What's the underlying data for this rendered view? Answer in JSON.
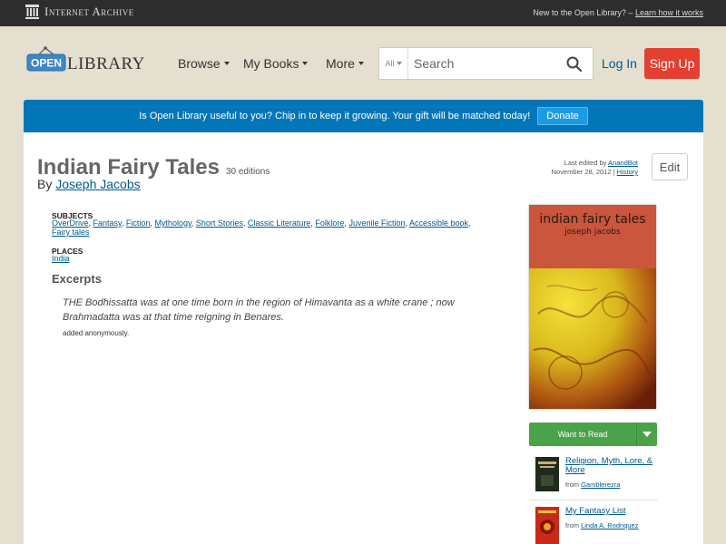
{
  "ia_bar": {
    "logo_text": "Internet Archive",
    "prompt": "New to the Open Library?",
    "link": "Learn how it works"
  },
  "header": {
    "logo_open": "OPEN",
    "logo_library": "LIBRARY",
    "nav": [
      {
        "label": "Browse"
      },
      {
        "label": "My Books"
      },
      {
        "label": "More"
      }
    ],
    "search": {
      "scope": "All",
      "placeholder": "Search"
    },
    "login": "Log In",
    "signup": "Sign Up"
  },
  "donate": {
    "message": "Is Open Library useful to you? Chip in to keep it growing. Your gift will be matched today!",
    "button": "Donate"
  },
  "work": {
    "title": "Indian Fairy Tales",
    "editions": "30 editions",
    "by": "By",
    "author": "Joseph Jacobs",
    "last_edited_label": "Last edited by",
    "last_edited_user": "AnandBot",
    "last_edited_date": "November 28, 2012",
    "history": "History",
    "edit_button": "Edit",
    "subjects_head": "Subjects",
    "subjects": [
      "OverDrive",
      "Fantasy",
      "Fiction",
      "Mythology",
      "Short Stories",
      "Classic Literature",
      "Folklore",
      "Juvenile Fiction",
      "Accessible book",
      "Fairy tales"
    ],
    "places_head": "Places",
    "places": [
      "India"
    ],
    "excerpts_head": "Excerpts",
    "excerpt": "THE Bodhissatta was at one time born in the region of Himavanta as a white crane ; now Brahmadatta was at that time reigning in Benares.",
    "excerpt_added": "added anonymously."
  },
  "cover": {
    "title": "indian fairy tales",
    "author": "joseph jacobs"
  },
  "want_to_read": "Want to Read",
  "lists": [
    {
      "title": "Religion, Myth, Lore, & More",
      "from_label": "from",
      "user": "Gamblerezra"
    },
    {
      "title": "My Fantasy List",
      "from_label": "from",
      "user": "Linda A. Rodriquez"
    }
  ],
  "colors": {
    "header_bg": "#e4dfcf",
    "ia_bar": "#2d2d2d",
    "donate_bar": "#0376b8",
    "signup": "#e43f30",
    "want_to_read": "#4aa348",
    "link": "#02598b"
  }
}
